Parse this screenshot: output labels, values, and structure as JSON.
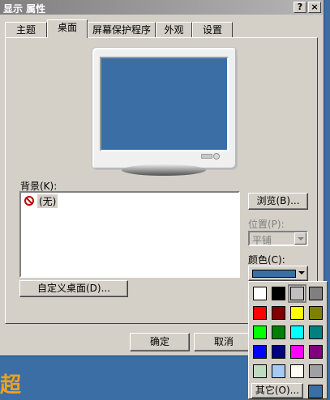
{
  "window": {
    "title": "显示 属性",
    "help_btn": "?",
    "close_btn": "×"
  },
  "tabs": [
    {
      "label": "主题",
      "active": false
    },
    {
      "label": "桌面",
      "active": true
    },
    {
      "label": "屏幕保护程序",
      "active": false
    },
    {
      "label": "外观",
      "active": false
    },
    {
      "label": "设置",
      "active": false
    }
  ],
  "background": {
    "label": "背景(K):",
    "items": [
      {
        "label": "(无)",
        "selected": true
      }
    ],
    "browse_button": "浏览(B)..."
  },
  "position": {
    "label": "位置(P):",
    "value": "平铺",
    "disabled": true
  },
  "color": {
    "label": "颜色(C):",
    "current": "#3a6ea5"
  },
  "customize_button": "自定义桌面(D)...",
  "footer": {
    "ok": "确定",
    "cancel": "取消"
  },
  "palette": {
    "colors": [
      "#ffffff",
      "#000000",
      "#c0c0c0",
      "#808080",
      "#ff0000",
      "#800000",
      "#ffff00",
      "#808000",
      "#00ff00",
      "#008000",
      "#00ffff",
      "#008080",
      "#0000ff",
      "#000080",
      "#ff00ff",
      "#800080",
      "#c0dcc0",
      "#a6caf0",
      "#fffbf0",
      "#a0a0a4"
    ],
    "selected_index": 2,
    "other_button": "其它(O)...",
    "current_swatch": "#3a6ea5"
  },
  "desktop_text": "超"
}
